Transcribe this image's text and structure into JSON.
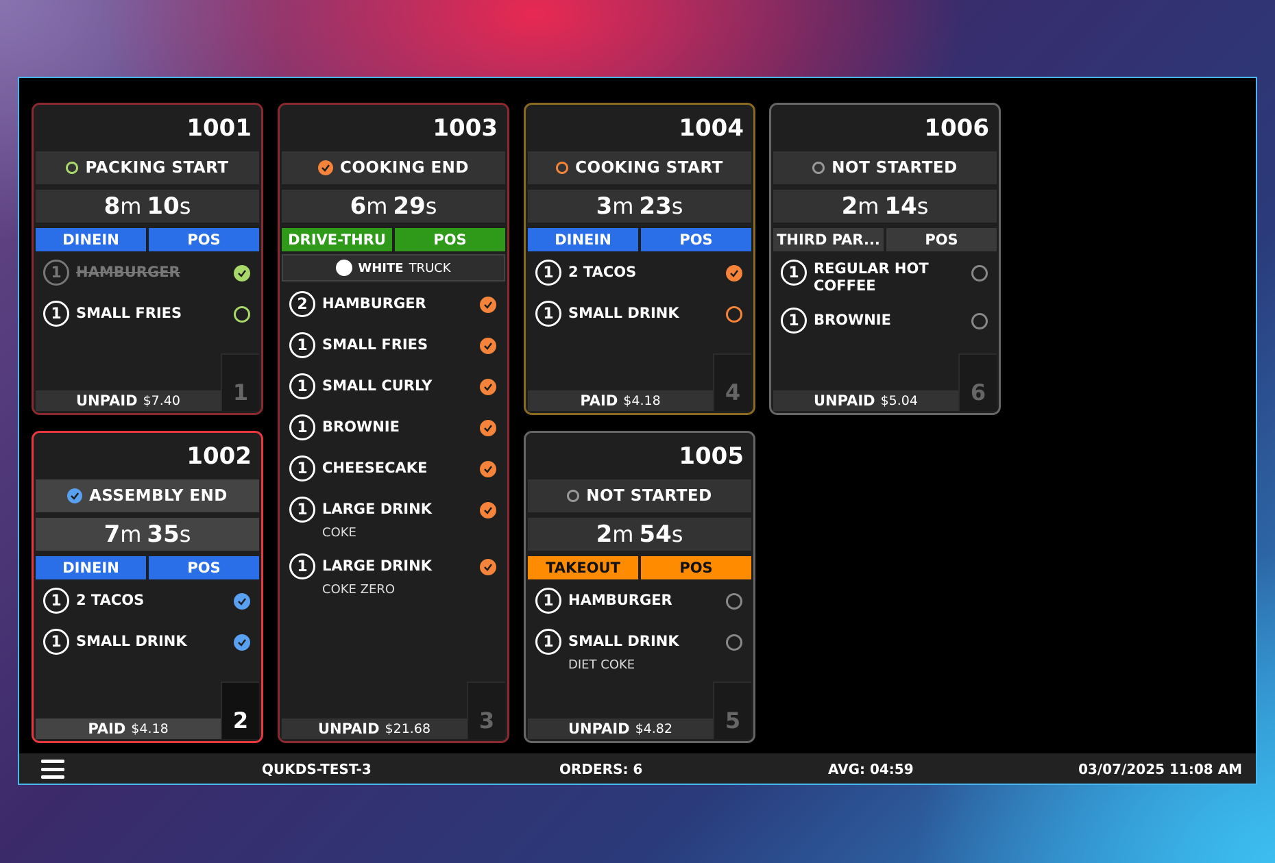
{
  "colors": {
    "blue": "#2b6fe8",
    "green": "#2f9a1a",
    "orange": "#ff8c00",
    "gray": "#3a3a3a",
    "check_green": "#a8d86a",
    "check_orange": "#f5843a",
    "check_blue": "#5aa0f0"
  },
  "orders": [
    {
      "number": "1001",
      "status": "PACKING START",
      "timer": {
        "m": "8",
        "s": "10"
      },
      "tags": [
        "DINEIN",
        "POS"
      ],
      "items": [
        {
          "qty": "1",
          "name": "HAMBURGER",
          "done": true
        },
        {
          "qty": "1",
          "name": "SMALL FRIES",
          "done": false
        }
      ],
      "payment": {
        "state": "UNPAID",
        "amount": "$7.40"
      },
      "slot": "1"
    },
    {
      "number": "1002",
      "status": "ASSEMBLY END",
      "timer": {
        "m": "7",
        "s": "35"
      },
      "tags": [
        "DINEIN",
        "POS"
      ],
      "items": [
        {
          "qty": "1",
          "name": "2 TACOS",
          "done": true
        },
        {
          "qty": "1",
          "name": "SMALL DRINK",
          "done": true
        }
      ],
      "payment": {
        "state": "PAID",
        "amount": "$4.18"
      },
      "slot": "2"
    },
    {
      "number": "1003",
      "status": "COOKING END",
      "timer": {
        "m": "6",
        "s": "29"
      },
      "tags": [
        "DRIVE-THRU",
        "POS"
      ],
      "source": {
        "bold": "WHITE",
        "rest": "TRUCK"
      },
      "items": [
        {
          "qty": "2",
          "name": "HAMBURGER",
          "done": true
        },
        {
          "qty": "1",
          "name": "SMALL FRIES",
          "done": true
        },
        {
          "qty": "1",
          "name": "SMALL CURLY",
          "done": true
        },
        {
          "qty": "1",
          "name": "BROWNIE",
          "done": true
        },
        {
          "qty": "1",
          "name": "CHEESECAKE",
          "done": true
        },
        {
          "qty": "1",
          "name": "LARGE DRINK",
          "mod": "COKE",
          "done": true
        },
        {
          "qty": "1",
          "name": "LARGE DRINK",
          "mod": "COKE ZERO",
          "done": true
        }
      ],
      "payment": {
        "state": "UNPAID",
        "amount": "$21.68"
      },
      "slot": "3"
    },
    {
      "number": "1004",
      "status": "COOKING START",
      "timer": {
        "m": "3",
        "s": "23"
      },
      "tags": [
        "DINEIN",
        "POS"
      ],
      "items": [
        {
          "qty": "1",
          "name": "2 TACOS",
          "done": true
        },
        {
          "qty": "1",
          "name": "SMALL DRINK",
          "done": false
        }
      ],
      "payment": {
        "state": "PAID",
        "amount": "$4.18"
      },
      "slot": "4"
    },
    {
      "number": "1005",
      "status": "NOT STARTED",
      "timer": {
        "m": "2",
        "s": "54"
      },
      "tags": [
        "TAKEOUT",
        "POS"
      ],
      "items": [
        {
          "qty": "1",
          "name": "HAMBURGER",
          "done": false
        },
        {
          "qty": "1",
          "name": "SMALL DRINK",
          "mod": "DIET COKE",
          "done": false
        }
      ],
      "payment": {
        "state": "UNPAID",
        "amount": "$4.82"
      },
      "slot": "5"
    },
    {
      "number": "1006",
      "status": "NOT STARTED",
      "timer": {
        "m": "2",
        "s": "14"
      },
      "tags": [
        "THIRD PAR...",
        "POS"
      ],
      "items": [
        {
          "qty": "1",
          "name": "REGULAR HOT COFFEE",
          "done": false
        },
        {
          "qty": "1",
          "name": "BROWNIE",
          "done": false
        }
      ],
      "payment": {
        "state": "UNPAID",
        "amount": "$5.04"
      },
      "slot": "6"
    }
  ],
  "footer": {
    "station": "QUKDS-TEST-3",
    "orders": "ORDERS: 6",
    "avg": "AVG: 04:59",
    "datetime": "03/07/2025 11:08 AM"
  },
  "icons": {
    "menu": "hamburger-menu-icon",
    "done": "check-circle-icon",
    "open": "empty-circle-icon"
  }
}
